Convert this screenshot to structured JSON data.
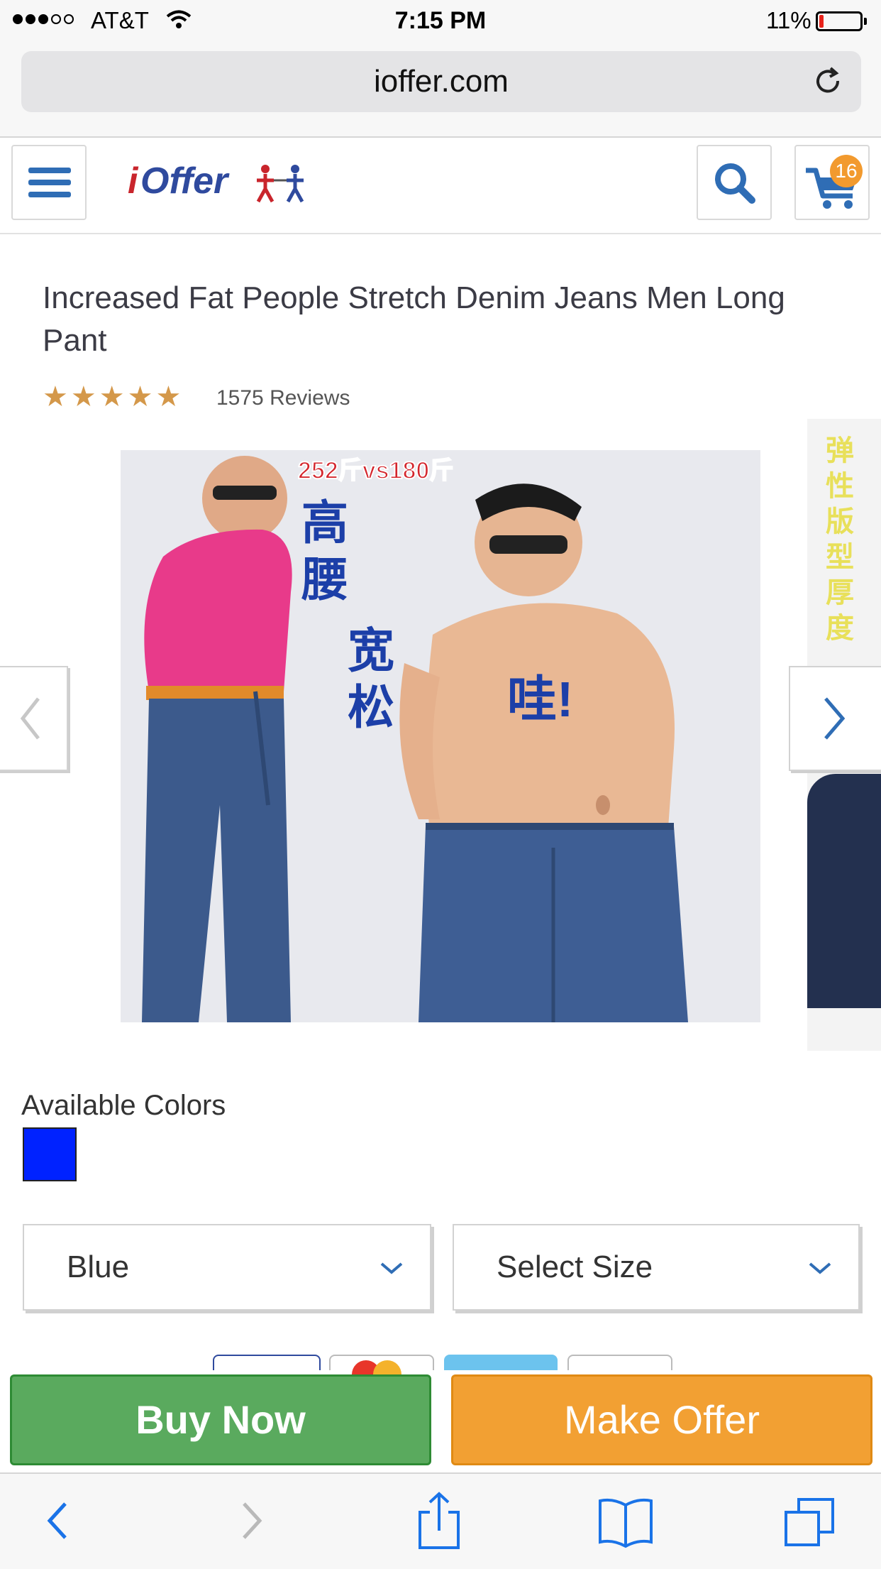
{
  "status_bar": {
    "carrier": "AT&T",
    "time": "7:15 PM",
    "battery": "11%",
    "battery_level": 0.11,
    "signal_bars": 3,
    "signal_total": 5
  },
  "browser": {
    "url": "ioffer.com"
  },
  "header": {
    "logo_text": "iOffer",
    "cart_count": "16",
    "icons": {
      "menu": "hamburger-menu-icon",
      "search": "search-icon",
      "cart": "shopping-cart-icon"
    }
  },
  "product": {
    "title": "Increased Fat People Stretch Denim Jeans Men Long Pant",
    "stars": "★★★★★",
    "rating": 5,
    "reviews": "1575 Reviews",
    "image_text": {
      "top_banner": "252斤vs180斤",
      "vertical_1": "高腰",
      "vertical_2": "宽松",
      "exclaim": "哇!",
      "side_text": "弹性 版型 厚度"
    }
  },
  "colors": {
    "label": "Available Colors",
    "swatch_color": "#0022ff"
  },
  "selects": {
    "color_value": "Blue",
    "size_placeholder": "Select Size"
  },
  "actions": {
    "buy_now": "Buy Now",
    "make_offer": "Make Offer"
  },
  "theme": {
    "brand_blue": "#2f6db5",
    "buy_green": "#5aaa5e",
    "offer_orange": "#f2a033",
    "star_gold": "#d4984a",
    "ios_blue": "#1a73e8"
  }
}
